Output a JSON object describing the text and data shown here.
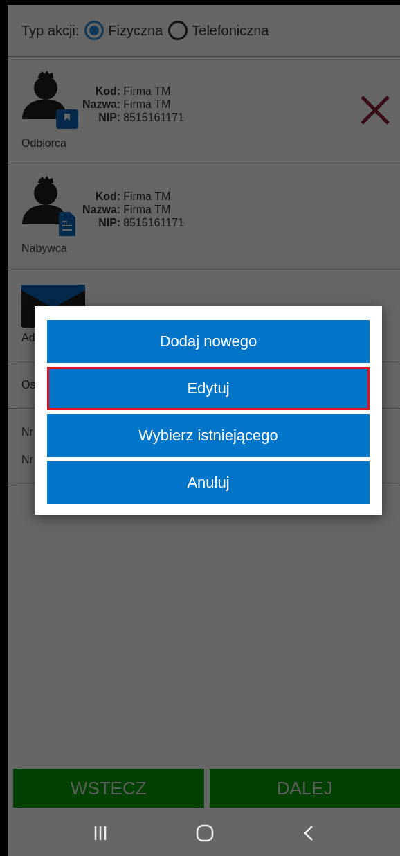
{
  "action_type": {
    "label": "Typ akcji:",
    "options": [
      {
        "label": "Fizyczna",
        "selected": true
      },
      {
        "label": "Telefoniczna",
        "selected": false
      }
    ]
  },
  "contacts": [
    {
      "kind": "recipient",
      "role": "Odbiorca",
      "removable": true,
      "fields": [
        {
          "key": "Kod:",
          "value": "Firma TM"
        },
        {
          "key": "Nazwa:",
          "value": "Firma TM"
        },
        {
          "key": "NIP:",
          "value": "8515161171"
        }
      ]
    },
    {
      "kind": "buyer",
      "role": "Nabywca",
      "removable": false,
      "fields": [
        {
          "key": "Kod:",
          "value": "Firma TM"
        },
        {
          "key": "Nazwa:",
          "value": "Firma TM"
        },
        {
          "key": "NIP:",
          "value": "8515161171"
        }
      ]
    }
  ],
  "address_row": {
    "label": "Ad"
  },
  "person_row": {
    "label": "Os"
  },
  "number_rows": [
    "Nr",
    "Nr"
  ],
  "dialog": {
    "buttons": [
      {
        "label": "Dodaj nowego",
        "focused": false
      },
      {
        "label": "Edytuj",
        "focused": true
      },
      {
        "label": "Wybierz istniejącego",
        "focused": false
      },
      {
        "label": "Anuluj",
        "focused": false
      }
    ]
  },
  "footer": {
    "buttons": [
      "WSTECZ",
      "DALEJ"
    ]
  }
}
